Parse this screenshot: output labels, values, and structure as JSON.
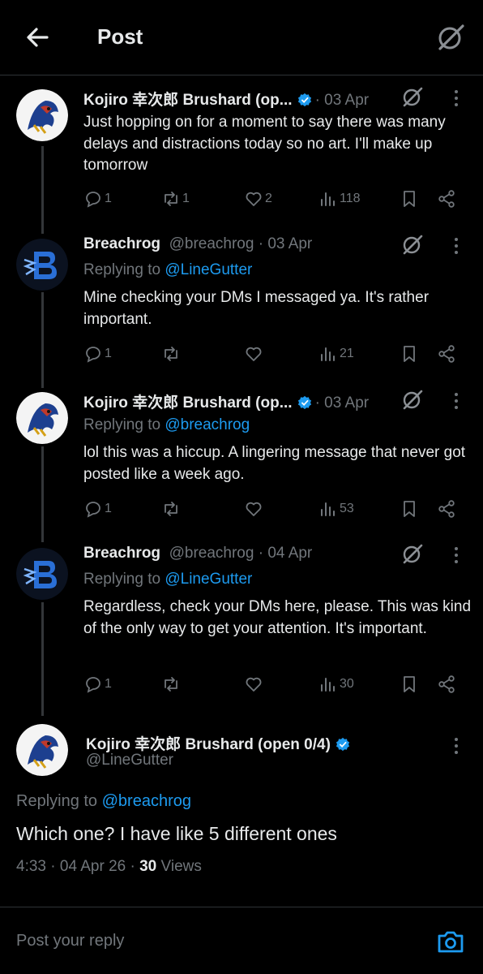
{
  "header": {
    "title": "Post",
    "back_icon": "arrow-left-icon",
    "grok_icon": "grok-icon"
  },
  "replies": [
    {
      "name": "Kojiro 幸次郎 Brushard (op...",
      "verified": true,
      "handle": "",
      "date": "03 Apr",
      "replying_prefix": "",
      "replying_to": "",
      "text": "Just hopping on for a moment to say there was many delays and distractions today so no art. I'll make up tomorrow",
      "replies_count": "1",
      "reposts_count": "1",
      "likes_count": "2",
      "views_count": "118"
    },
    {
      "name": "Breachrog",
      "verified": false,
      "handle": "@breachrog",
      "date": "03 Apr",
      "replying_prefix": "Replying to",
      "replying_to": "@LineGutter",
      "text": "Mine checking your DMs I messaged ya. It's rather important.",
      "replies_count": "1",
      "reposts_count": "",
      "likes_count": "",
      "views_count": "21"
    },
    {
      "name": "Kojiro 幸次郎 Brushard (op...",
      "verified": true,
      "handle": "",
      "date": "03 Apr",
      "replying_prefix": "Replying to",
      "replying_to": "@breachrog",
      "text": "lol this was a hiccup. A lingering message that never got posted like a week ago.",
      "replies_count": "1",
      "reposts_count": "",
      "likes_count": "",
      "views_count": "53"
    },
    {
      "name": "Breachrog",
      "verified": false,
      "handle": "@breachrog",
      "date": "04 Apr",
      "replying_prefix": "Replying to",
      "replying_to": "@LineGutter",
      "text": "Regardless, check your DMs here, please. This was kind of the only way to get your attention. It's important.",
      "replies_count": "1",
      "reposts_count": "",
      "likes_count": "",
      "views_count": "30"
    }
  ],
  "main_post": {
    "name": "Kojiro 幸次郎 Brushard (open 0/4)",
    "handle": "@LineGutter",
    "replying_prefix": "Replying to",
    "replying_to": "@breachrog",
    "text": "Which one? I have like 5 different ones",
    "time": "4:33",
    "date": "04 Apr 26",
    "views_count": "30",
    "views_label": "Views"
  },
  "composer": {
    "placeholder": "Post your reply",
    "camera_icon": "camera-icon"
  },
  "colors": {
    "background": "#000000",
    "accent": "#1d9bf0",
    "muted": "#71767b",
    "text": "#e7e9ea"
  }
}
